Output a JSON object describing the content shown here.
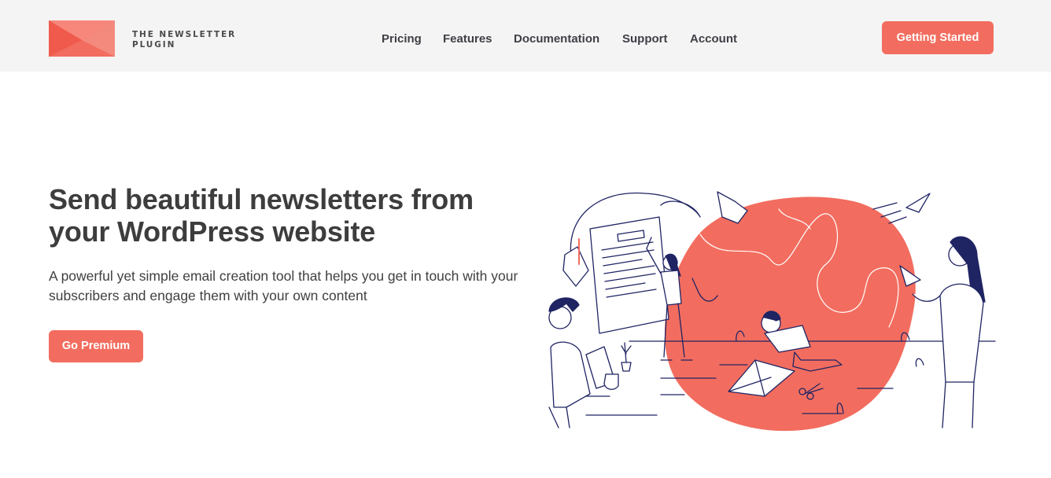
{
  "brand": {
    "name_line1": "THE NEWSLETTER",
    "name_line2": "PLUGIN",
    "icon": "envelope-logo-icon",
    "color": "#f26d5f"
  },
  "nav": {
    "items": [
      {
        "label": "Pricing"
      },
      {
        "label": "Features"
      },
      {
        "label": "Documentation"
      },
      {
        "label": "Support"
      },
      {
        "label": "Account"
      }
    ]
  },
  "header": {
    "cta_label": "Getting Started"
  },
  "hero": {
    "title": "Send beautiful newsletters from your WordPress website",
    "subtitle": "A powerful yet simple email creation tool that helps you get in touch with your subscribers and engage them with your own content",
    "button_label": "Go Premium",
    "illustration": "people-making-paper-planes-illustration"
  },
  "colors": {
    "accent": "#f26d5f",
    "header_bg": "#f4f4f4",
    "ink": "#1f2463",
    "text": "#3d3d3d"
  }
}
